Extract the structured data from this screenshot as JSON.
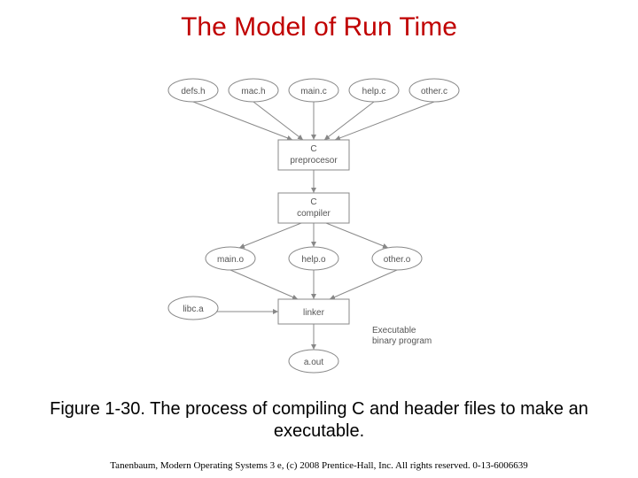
{
  "title": "The Model of Run Time",
  "caption": "Figure 1-30. The process of compiling C and header files to make an executable.",
  "footer": "Tanenbaum, Modern Operating Systems 3 e, (c) 2008 Prentice-Hall, Inc. All rights reserved. 0-13-6006639",
  "diagram": {
    "sources": {
      "defsh": "defs.h",
      "mach": "mac.h",
      "mainc": "main.c",
      "helpc": "help.c",
      "otherc": "other.c"
    },
    "stages": {
      "preproc_l1": "C",
      "preproc_l2": "preprocesor",
      "compiler_l1": "C",
      "compiler_l2": "compiler",
      "linker": "linker"
    },
    "objects": {
      "maino": "main.o",
      "helpo": "help.o",
      "othero": "other.o",
      "libca": "libc.a",
      "aout": "a.out"
    },
    "note_l1": "Executable",
    "note_l2": "binary program"
  }
}
